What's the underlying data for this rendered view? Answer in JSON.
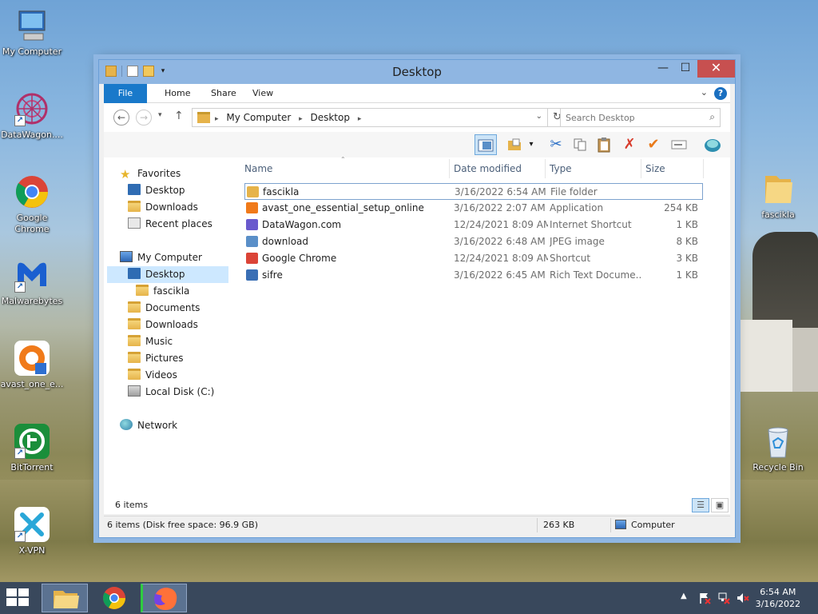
{
  "desktop": {
    "icons": [
      {
        "label": "My Computer"
      },
      {
        "label": "DataWagon...."
      },
      {
        "label": "Google Chrome"
      },
      {
        "label": "Malwarebytes"
      },
      {
        "label": "avast_one_e..."
      },
      {
        "label": "BitTorrent"
      },
      {
        "label": "X-VPN"
      },
      {
        "label": "fascikla"
      },
      {
        "label": "Recycle Bin"
      }
    ]
  },
  "window": {
    "title": "Desktop",
    "minimize": "—",
    "maximize": "☐",
    "close": "✕"
  },
  "ribbon": {
    "tabs": [
      "File",
      "Home",
      "Share",
      "View"
    ]
  },
  "address": {
    "crumbs": [
      "My Computer",
      "Desktop"
    ],
    "search_placeholder": "Search Desktop"
  },
  "nav": {
    "favorites": "Favorites",
    "fav_items": [
      "Desktop",
      "Downloads",
      "Recent places"
    ],
    "computer": "My Computer",
    "computer_items": [
      "Desktop",
      "fascikla",
      "Documents",
      "Downloads",
      "Music",
      "Pictures",
      "Videos",
      "Local Disk (C:)"
    ],
    "network": "Network"
  },
  "columns": {
    "name": "Name",
    "date": "Date modified",
    "type": "Type",
    "size": "Size"
  },
  "files": [
    {
      "name": "fascikla",
      "date": "3/16/2022 6:54 AM",
      "type": "File folder",
      "size": "",
      "icon": "folder-icon",
      "color": "#e6b34a"
    },
    {
      "name": "avast_one_essential_setup_online",
      "date": "3/16/2022 2:07 AM",
      "type": "Application",
      "size": "254 KB",
      "icon": "avast-icon",
      "color": "#f07a1a"
    },
    {
      "name": "DataWagon.com",
      "date": "12/24/2021 8:09 AM",
      "type": "Internet Shortcut",
      "size": "1 KB",
      "icon": "internet-shortcut-icon",
      "color": "#6a5acd"
    },
    {
      "name": "download",
      "date": "3/16/2022 6:48 AM",
      "type": "JPEG image",
      "size": "8 KB",
      "icon": "image-icon",
      "color": "#5a8fc8"
    },
    {
      "name": "Google Chrome",
      "date": "12/24/2021 8:09 AM",
      "type": "Shortcut",
      "size": "3 KB",
      "icon": "chrome-icon",
      "color": "#db4437"
    },
    {
      "name": "sifre",
      "date": "3/16/2022 6:45 AM",
      "type": "Rich Text Docume...",
      "size": "1 KB",
      "icon": "document-icon",
      "color": "#3a6fb5"
    }
  ],
  "status": {
    "count": "6 items",
    "summary": "6 items (Disk free space: 96.9 GB)",
    "size": "263 KB",
    "location": "Computer"
  },
  "clock": {
    "time": "6:54 AM",
    "date": "3/16/2022"
  }
}
